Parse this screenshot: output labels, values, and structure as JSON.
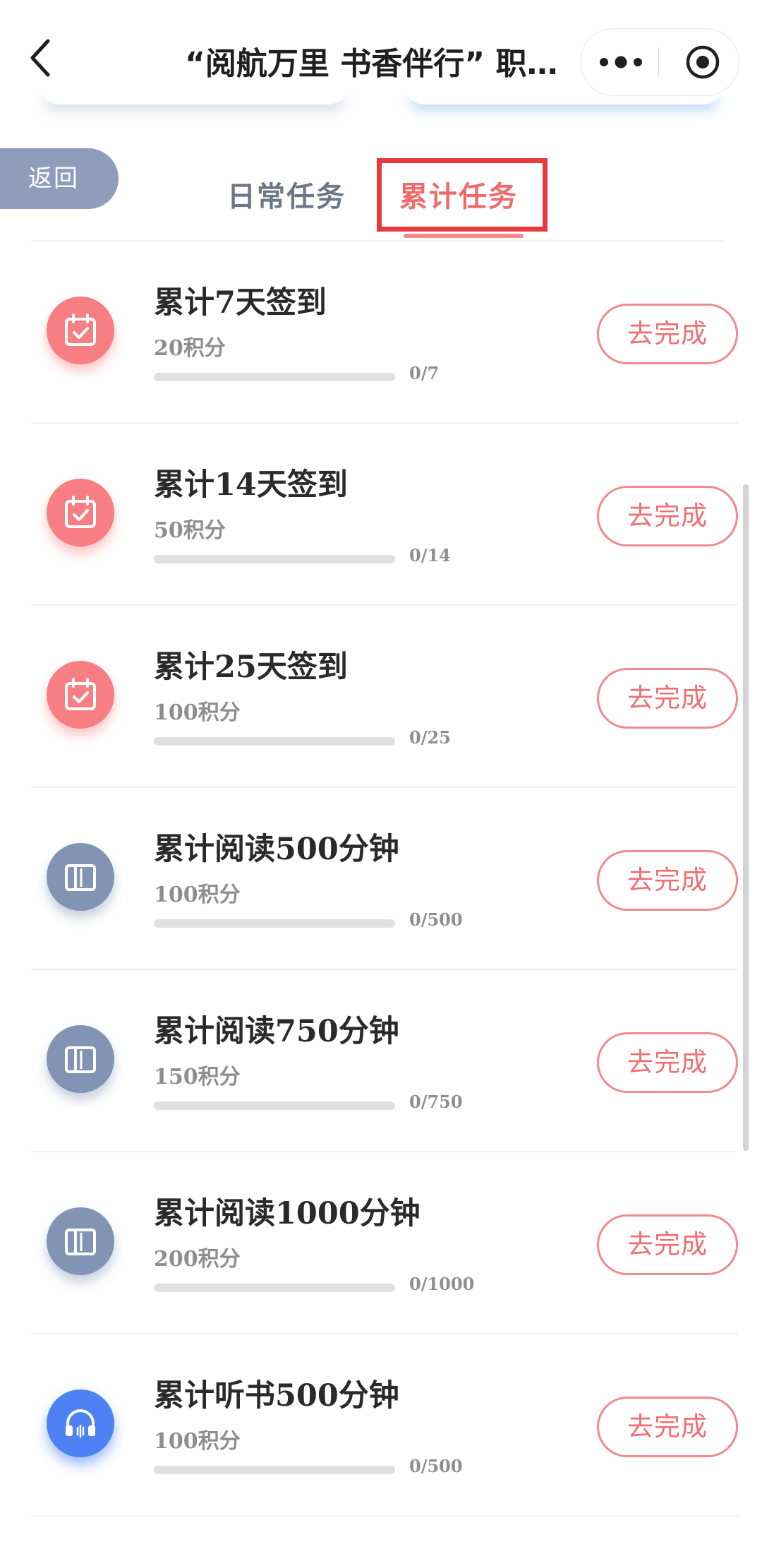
{
  "nav": {
    "title": "“阅航万里 书香伴行” 职…"
  },
  "return_label": "返回",
  "tabs": {
    "daily": "日常任务",
    "cumulative": "累计任务",
    "active": "cumulative"
  },
  "tasks": [
    {
      "icon": "calendar-check-icon",
      "title": "累计7天签到",
      "points": "20积分",
      "progress": "0/7",
      "progress_fraction": 0,
      "button": "去完成"
    },
    {
      "icon": "calendar-check-icon",
      "title": "累计14天签到",
      "points": "50积分",
      "progress": "0/14",
      "progress_fraction": 0,
      "button": "去完成"
    },
    {
      "icon": "calendar-check-icon",
      "title": "累计25天签到",
      "points": "100积分",
      "progress": "0/25",
      "progress_fraction": 0,
      "button": "去完成"
    },
    {
      "icon": "book-icon",
      "title": "累计阅读500分钟",
      "points": "100积分",
      "progress": "0/500",
      "progress_fraction": 0,
      "button": "去完成"
    },
    {
      "icon": "book-icon",
      "title": "累计阅读750分钟",
      "points": "150积分",
      "progress": "0/750",
      "progress_fraction": 0,
      "button": "去完成"
    },
    {
      "icon": "book-icon",
      "title": "累计阅读1000分钟",
      "points": "200积分",
      "progress": "0/1000",
      "progress_fraction": 0,
      "button": "去完成"
    },
    {
      "icon": "headphone-icon",
      "title": "累计听书500分钟",
      "points": "100积分",
      "progress": "0/500",
      "progress_fraction": 0,
      "button": "去完成"
    }
  ],
  "colors": {
    "accent": "#ef6a6c",
    "highlight_box": "#e63a3f",
    "calendar_icon_bg": "#f77f83",
    "book_icon_bg": "#8294b4",
    "headphone_icon_bg": "#4f81f4",
    "return_pill_bg": "#8d9dbb"
  }
}
